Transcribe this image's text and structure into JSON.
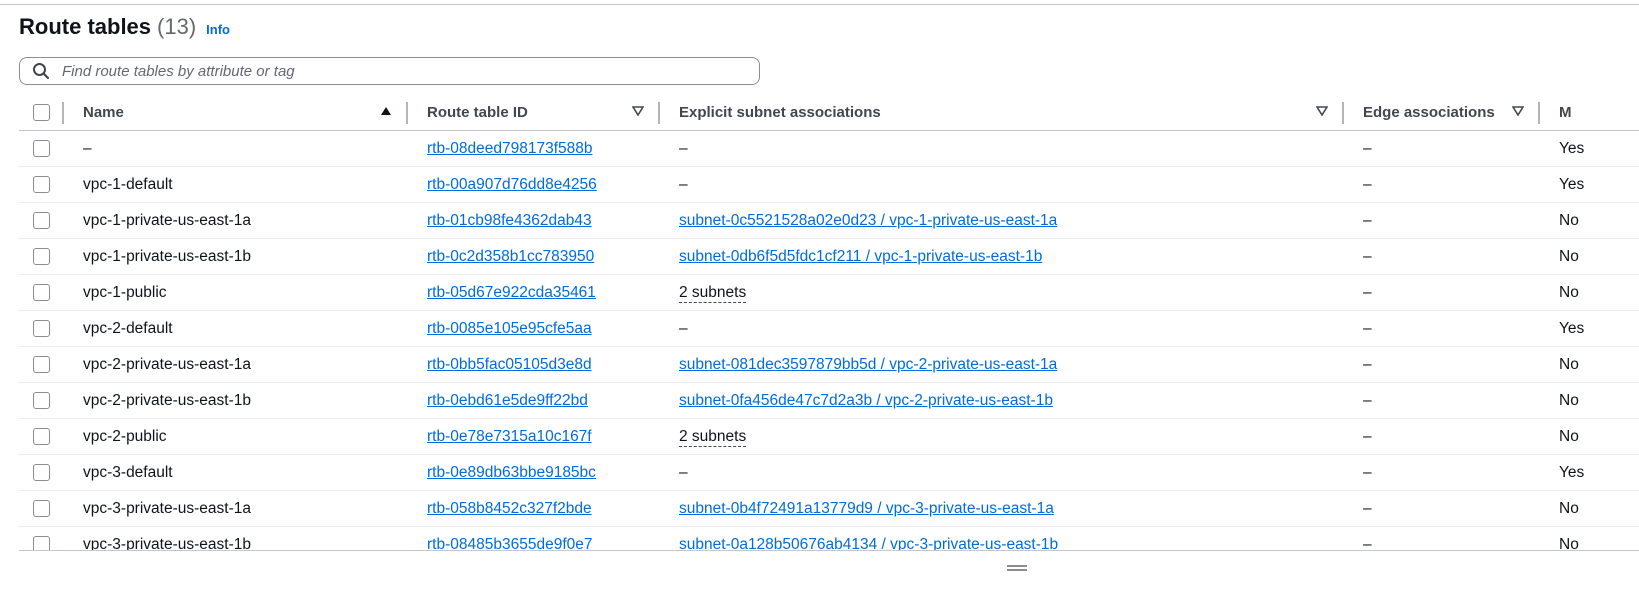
{
  "header": {
    "title": "Route tables",
    "count": "(13)",
    "info": "Info"
  },
  "search": {
    "placeholder": "Find route tables by attribute or tag"
  },
  "columns": {
    "name": "Name",
    "id": "Route table ID",
    "explicit": "Explicit subnet associations",
    "edge": "Edge associations",
    "main": "M"
  },
  "rows": [
    {
      "name": "–",
      "id": "rtb-08deed798173f588b",
      "explicit": "–",
      "explicit_type": "dash",
      "edge": "–",
      "main": "Yes"
    },
    {
      "name": "vpc-1-default",
      "id": "rtb-00a907d76dd8e4256",
      "explicit": "–",
      "explicit_type": "dash",
      "edge": "–",
      "main": "Yes"
    },
    {
      "name": "vpc-1-private-us-east-1a",
      "id": "rtb-01cb98fe4362dab43",
      "explicit": "subnet-0c5521528a02e0d23 / vpc-1-private-us-east-1a",
      "explicit_type": "link",
      "edge": "–",
      "main": "No"
    },
    {
      "name": "vpc-1-private-us-east-1b",
      "id": "rtb-0c2d358b1cc783950",
      "explicit": "subnet-0db6f5d5fdc1cf211 / vpc-1-private-us-east-1b",
      "explicit_type": "link",
      "edge": "–",
      "main": "No"
    },
    {
      "name": "vpc-1-public",
      "id": "rtb-05d67e922cda35461",
      "explicit": "2 subnets",
      "explicit_type": "dotted",
      "edge": "–",
      "main": "No"
    },
    {
      "name": "vpc-2-default",
      "id": "rtb-0085e105e95cfe5aa",
      "explicit": "–",
      "explicit_type": "dash",
      "edge": "–",
      "main": "Yes"
    },
    {
      "name": "vpc-2-private-us-east-1a",
      "id": "rtb-0bb5fac05105d3e8d",
      "explicit": "subnet-081dec3597879bb5d / vpc-2-private-us-east-1a",
      "explicit_type": "link",
      "edge": "–",
      "main": "No"
    },
    {
      "name": "vpc-2-private-us-east-1b",
      "id": "rtb-0ebd61e5de9ff22bd",
      "explicit": "subnet-0fa456de47c7d2a3b / vpc-2-private-us-east-1b",
      "explicit_type": "link",
      "edge": "–",
      "main": "No"
    },
    {
      "name": "vpc-2-public",
      "id": "rtb-0e78e7315a10c167f",
      "explicit": "2 subnets",
      "explicit_type": "dotted",
      "edge": "–",
      "main": "No"
    },
    {
      "name": "vpc-3-default",
      "id": "rtb-0e89db63bbe9185bc",
      "explicit": "–",
      "explicit_type": "dash",
      "edge": "–",
      "main": "Yes"
    },
    {
      "name": "vpc-3-private-us-east-1a",
      "id": "rtb-058b8452c327f2bde",
      "explicit": "subnet-0b4f72491a13779d9 / vpc-3-private-us-east-1a",
      "explicit_type": "link",
      "edge": "–",
      "main": "No"
    },
    {
      "name": "vpc-3-private-us-east-1b",
      "id": "rtb-08485b3655de9f0e7",
      "explicit": "subnet-0a128b50676ab4134 / vpc-3-private-us-east-1b",
      "explicit_type": "link",
      "edge": "–",
      "main": "No"
    }
  ],
  "icons": {
    "search": "search-icon",
    "sort_asc": "caret-up-icon",
    "sort_none": "caret-down-outline-icon",
    "resize": "resize-handle-icon"
  },
  "colors": {
    "link": "#006ce0",
    "text": "#0f141a",
    "border": "#c6c6cd"
  }
}
